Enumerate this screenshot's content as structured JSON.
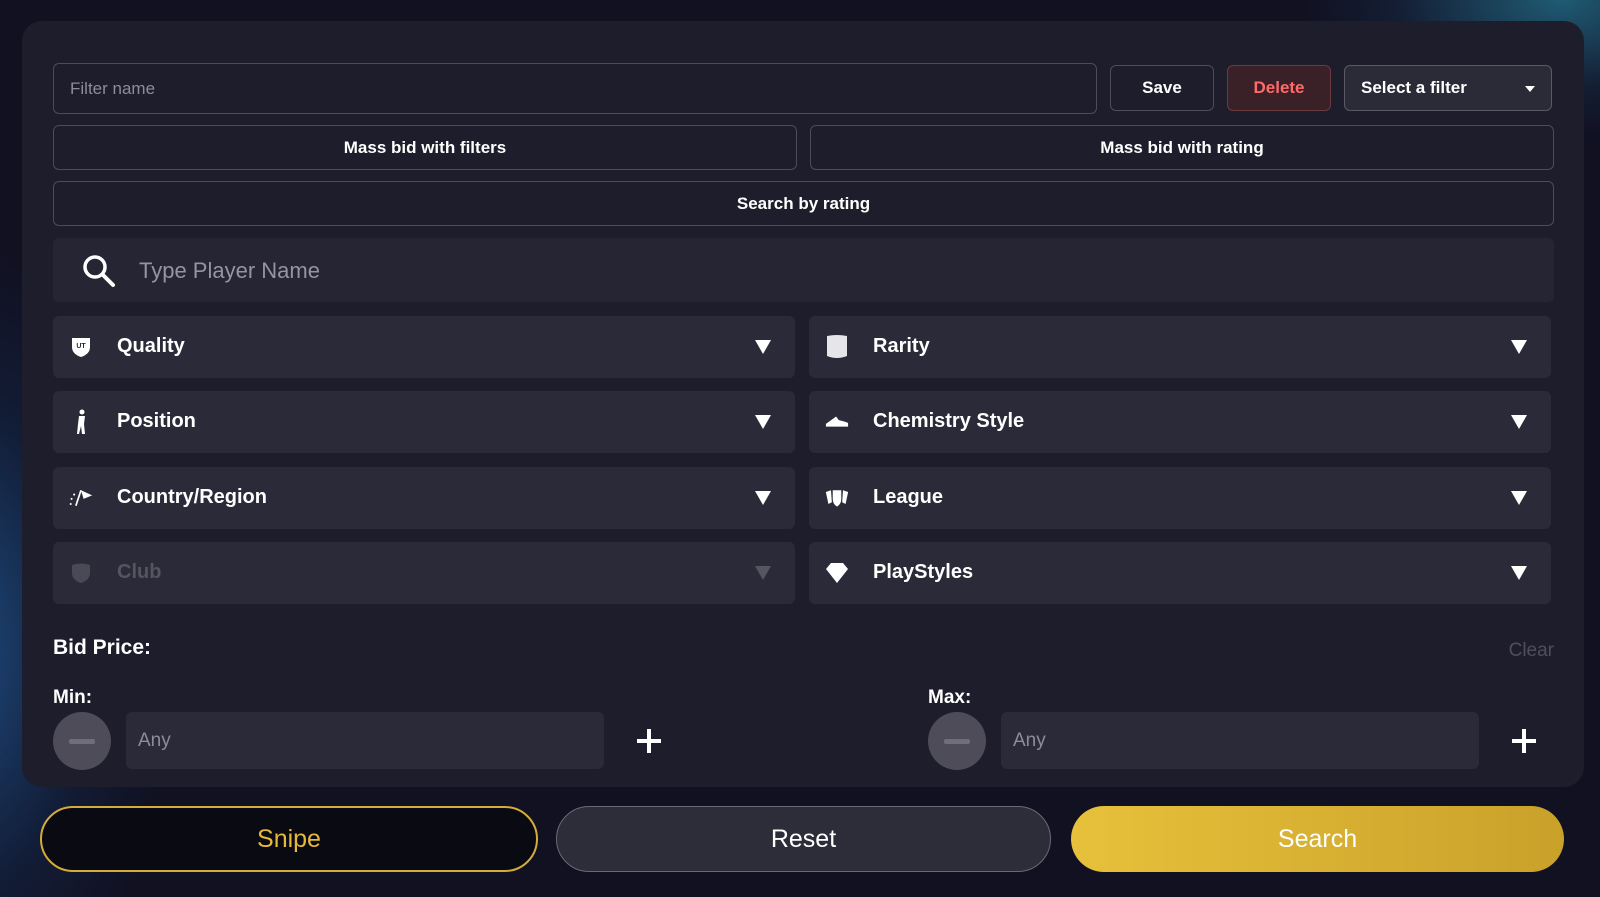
{
  "filter_bar": {
    "name_placeholder": "Filter name",
    "save_label": "Save",
    "delete_label": "Delete",
    "select_label": "Select a filter"
  },
  "actions": {
    "mass_bid_filters": "Mass bid with filters",
    "mass_bid_rating": "Mass bid with rating",
    "search_by_rating": "Search by rating"
  },
  "player_search": {
    "placeholder": "Type Player Name"
  },
  "dropdowns": [
    {
      "label": "Quality",
      "icon": "ut-shield-icon"
    },
    {
      "label": "Rarity",
      "icon": "card-icon"
    },
    {
      "label": "Position",
      "icon": "player-figure-icon"
    },
    {
      "label": "Chemistry Style",
      "icon": "boot-icon"
    },
    {
      "label": "Country/Region",
      "icon": "flag-icon"
    },
    {
      "label": "League",
      "icon": "league-shields-icon"
    },
    {
      "label": "Club",
      "icon": "club-shield-icon",
      "disabled": true
    },
    {
      "label": "PlayStyles",
      "icon": "diamond-icon"
    }
  ],
  "bid_price": {
    "title": "Bid Price:",
    "clear_label": "Clear",
    "min_label": "Min:",
    "max_label": "Max:",
    "min_placeholder": "Any",
    "max_placeholder": "Any"
  },
  "bottom": {
    "snipe_label": "Snipe",
    "reset_label": "Reset",
    "search_label": "Search"
  },
  "colors": {
    "accent_gold": "#e7c13b",
    "delete_red": "#ff6b6b",
    "panel_bg": "#1e1d2b"
  }
}
